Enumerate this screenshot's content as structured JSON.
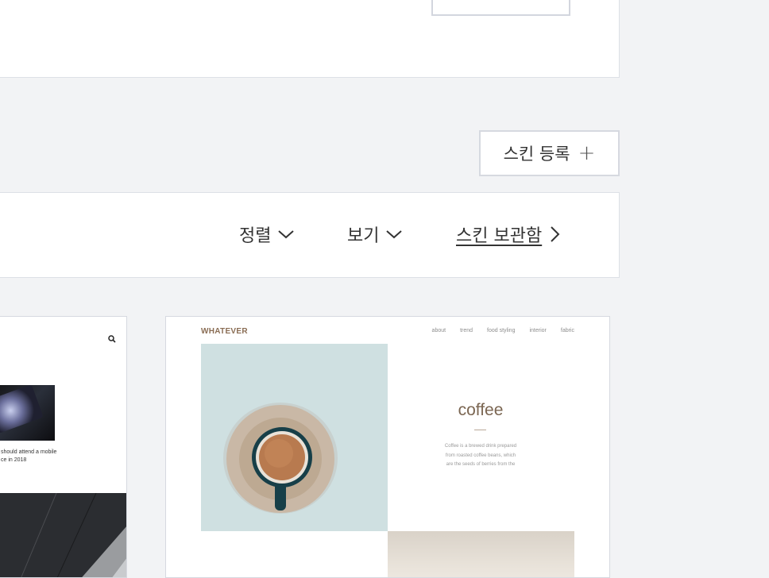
{
  "register_button": {
    "label": "스킨 등록",
    "icon": "plus-icon"
  },
  "toolbar": {
    "sort_label": "정렬",
    "view_label": "보기",
    "storage_label": "스킨 보관함"
  },
  "cards": [
    {
      "name": "skin-preview-left",
      "snippet_lines": [
        "should attend a mobile",
        "ce in 2018"
      ]
    },
    {
      "name": "skin-preview-whatever",
      "logo": "WHATEVER",
      "nav": [
        "about",
        "trend",
        "food styling",
        "interior",
        "fabric"
      ],
      "title": "coffee",
      "desc_lines": [
        "Coffee is a brewed drink prepared",
        "from roasted coffee beans, which",
        "are the seeds of berries from the"
      ]
    }
  ],
  "colors": {
    "background": "#f2f3f5",
    "panel": "#ffffff",
    "border": "#dde0e6",
    "logo_brown": "#8a6d54",
    "cup_teal": "#173f48"
  }
}
